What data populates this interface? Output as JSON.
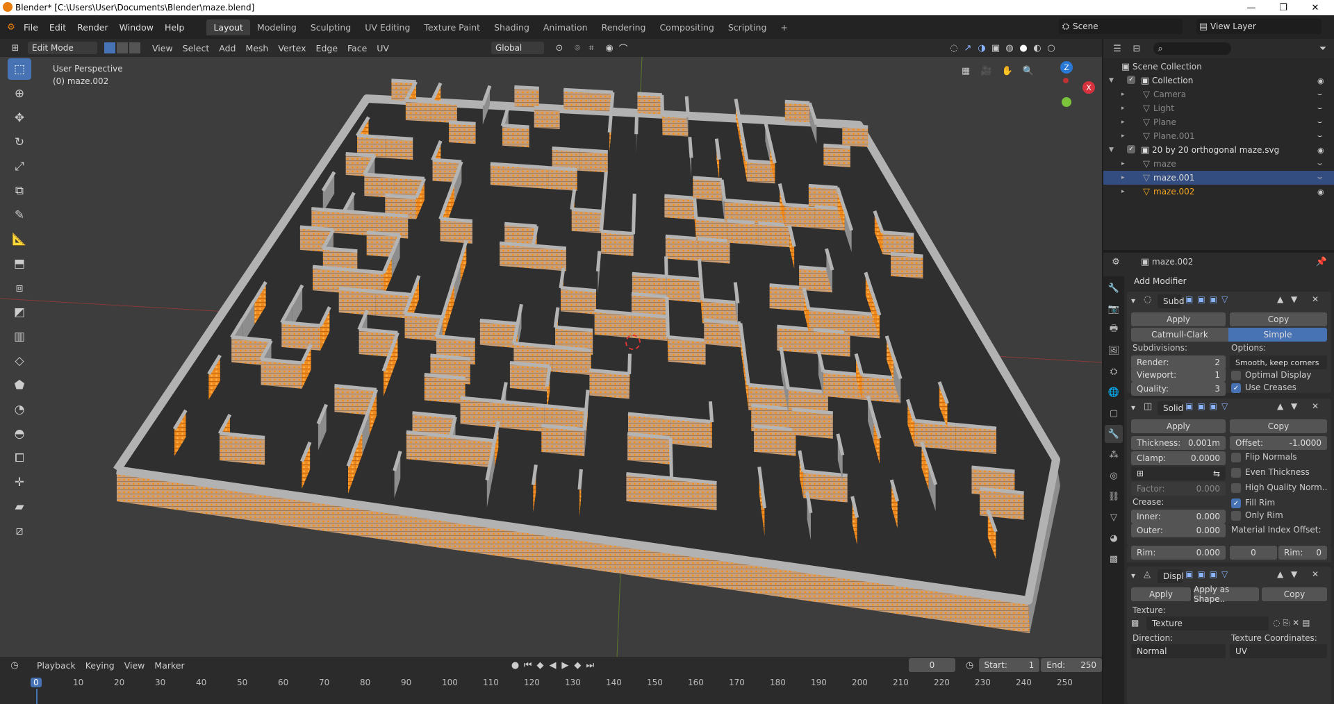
{
  "window": {
    "title": "Blender* [C:\\Users\\User\\Documents\\Blender\\maze.blend]",
    "min": "—",
    "max": "❐",
    "close": "✕"
  },
  "menu": {
    "items": [
      "File",
      "Edit",
      "Render",
      "Window",
      "Help"
    ],
    "workspaces": [
      "Layout",
      "Modeling",
      "Sculpting",
      "UV Editing",
      "Texture Paint",
      "Shading",
      "Animation",
      "Rendering",
      "Compositing",
      "Scripting"
    ],
    "add_tab": "+",
    "scene": "Scene",
    "view_layer": "View Layer"
  },
  "header": {
    "mode": "Edit Mode",
    "items": [
      "View",
      "Select",
      "Add",
      "Mesh",
      "Vertex",
      "Edge",
      "Face",
      "UV"
    ],
    "orientation": "Global"
  },
  "viewport": {
    "persp": "User Perspective",
    "object": "(0) maze.002",
    "gizmo": {
      "z": "Z",
      "x": "X"
    },
    "colors": {
      "bg": "#3d3d3d",
      "wall": "#a8a8a8",
      "wall_side": "#8d8d8d",
      "floor": "#2e2e2e",
      "vertex": "#ff8a00"
    }
  },
  "outliner": {
    "scene_collection": "Scene Collection",
    "rows": [
      {
        "name": "Collection",
        "indent": 1,
        "type": "collection"
      },
      {
        "name": "Camera",
        "indent": 2,
        "type": "object",
        "dim": true
      },
      {
        "name": "Light",
        "indent": 2,
        "type": "object",
        "dim": true
      },
      {
        "name": "Plane",
        "indent": 2,
        "type": "object",
        "dim": true
      },
      {
        "name": "Plane.001",
        "indent": 2,
        "type": "object",
        "dim": true
      },
      {
        "name": "20 by 20 orthogonal maze.svg",
        "indent": 1,
        "type": "collection"
      },
      {
        "name": "maze",
        "indent": 2,
        "type": "object",
        "dim": true
      },
      {
        "name": "maze.001",
        "indent": 2,
        "type": "object",
        "selected": true
      },
      {
        "name": "maze.002",
        "indent": 2,
        "type": "object",
        "active": true
      }
    ]
  },
  "properties": {
    "object": "maze.002",
    "add_modifier": "Add Modifier",
    "subd": {
      "name": "Subd",
      "apply": "Apply",
      "copy": "Copy",
      "catmull": "Catmull-Clark",
      "simple": "Simple",
      "subdivisions": "Subdivisions:",
      "render_l": "Render:",
      "render_v": "2",
      "viewport_l": "Viewport:",
      "viewport_v": "1",
      "quality_l": "Quality:",
      "quality_v": "3",
      "options": "Options:",
      "uv_smooth": "Smooth, keep corners",
      "optimal": "Optimal Display",
      "creases": "Use Creases"
    },
    "solid": {
      "name": "Solid",
      "apply": "Apply",
      "copy": "Copy",
      "thick_l": "Thickness:",
      "thick_v": "0.001m",
      "offset_l": "Offset:",
      "offset_v": "-1.0000",
      "clamp_l": "Clamp:",
      "clamp_v": "0.0000",
      "flip": "Flip Normals",
      "even": "Even Thickness",
      "hq": "High Quality Norm..",
      "factor_l": "Factor:",
      "factor_v": "0.000",
      "fill": "Fill Rim",
      "only": "Only Rim",
      "crease": "Crease:",
      "inner_l": "Inner:",
      "inner_v": "0.000",
      "outer_l": "Outer:",
      "outer_v": "0.000",
      "rim_l": "Rim:",
      "rim_v": "0.000",
      "mat_off": "Material Index Offset:",
      "mat_v": "0",
      "mat_rim_l": "Rim:",
      "mat_rim_v": "0"
    },
    "displ": {
      "name": "Displ",
      "apply": "Apply",
      "apply_shape": "Apply as Shape..",
      "copy": "Copy",
      "texture_l": "Texture:",
      "texture_v": "Texture",
      "direction_l": "Direction:",
      "direction_v": "Normal",
      "texcoords_l": "Texture Coordinates:",
      "texcoords_v": "UV"
    }
  },
  "timeline": {
    "playback": "Playback",
    "keying": "Keying",
    "view": "View",
    "marker": "Marker",
    "frame": "0",
    "start_l": "Start:",
    "start_v": "1",
    "end_l": "End:",
    "end_v": "250",
    "ticks": [
      "0",
      "10",
      "20",
      "30",
      "40",
      "50",
      "60",
      "70",
      "80",
      "90",
      "100",
      "110",
      "120",
      "130",
      "140",
      "150",
      "160",
      "170",
      "180",
      "190",
      "200",
      "210",
      "220",
      "230",
      "240",
      "250"
    ]
  }
}
